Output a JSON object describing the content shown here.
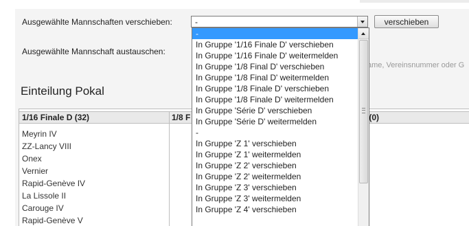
{
  "move_row": {
    "label": "Ausgewählte Mannschaften verschieben:",
    "selected": "-",
    "button": "verschieben"
  },
  "swap_row": {
    "label": "Ausgewählte Mannschaft austauschen:",
    "hint": "ame, Vereinsnummer oder G"
  },
  "section": {
    "title": "Einteilung Pokal"
  },
  "table": {
    "columns": [
      "1/16 Finale D (32)",
      "1/8 F",
      ") (0)"
    ],
    "teams": [
      "Meyrin IV",
      "ZZ-Lancy VIII",
      "Onex",
      "Vernier",
      "Rapid-Genève IV",
      "La Lissole II",
      "Carouge IV",
      "Rapid-Genève V"
    ]
  },
  "dropdown": {
    "options": [
      "-",
      "In Gruppe '1/16 Finale D' verschieben",
      "In Gruppe '1/16 Finale D' weitermelden",
      "In Gruppe '1/8 Final D' verschieben",
      "In Gruppe '1/8 Final D' weitermelden",
      "In Gruppe '1/8 Finale D' verschieben",
      "In Gruppe '1/8 Finale D' weitermelden",
      "In Gruppe 'Série D' verschieben",
      "In Gruppe 'Série D' weitermelden",
      "-",
      "In Gruppe 'Z 1' verschieben",
      "In Gruppe 'Z 1' weitermelden",
      "In Gruppe 'Z 2' verschieben",
      "In Gruppe 'Z 2' weitermelden",
      "In Gruppe 'Z 3' verschieben",
      "In Gruppe 'Z 3' weitermelden",
      "In Gruppe 'Z 4' verschieben"
    ],
    "selected_index": 0
  },
  "colors": {
    "selection": "#3399ff",
    "panel": "#f4f4f4",
    "header": "#e9e9e9"
  },
  "icons": {
    "select_arrow": "chevron-down-icon",
    "scroll_up": "scroll-up-arrow-icon"
  }
}
